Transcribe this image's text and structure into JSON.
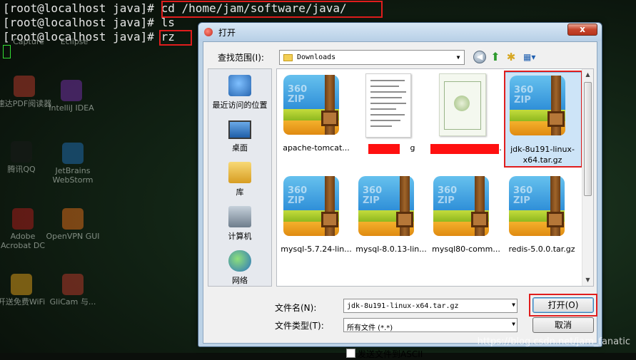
{
  "terminal": {
    "lines": [
      {
        "prompt": "[root@localhost java]# ",
        "cmd": "cd /home/jam/software/java/"
      },
      {
        "prompt": "[root@localhost java]# ",
        "cmd": "ls"
      },
      {
        "prompt": "[root@localhost java]# ",
        "cmd": "rz"
      }
    ]
  },
  "desktop": {
    "icons": [
      "Capture",
      "Eclipse",
      "速达PDF阅读器",
      "IntelliJ IDEA",
      "腾讯QQ",
      "JetBrains WebStorm",
      "Adobe Acrobat DC",
      "OpenVPN GUI",
      "开送免费WiFi",
      "GliCam 与..."
    ]
  },
  "dialog": {
    "title": "打开",
    "close_label": "x",
    "look_in_label": "查找范围(I):",
    "look_in_value": "Downloads",
    "places": [
      "最近访问的位置",
      "桌面",
      "库",
      "计算机",
      "网络"
    ],
    "files": [
      {
        "name": "apache-tomcat...",
        "kind": "archive"
      },
      {
        "name": "g",
        "kind": "doc"
      },
      {
        "name": ".",
        "kind": "cert"
      },
      {
        "name": "jdk-8u191-linux-x64.tar.gz",
        "kind": "archive",
        "selected": true
      },
      {
        "name": "mysql-5.7.24-lin...",
        "kind": "archive"
      },
      {
        "name": "mysql-8.0.13-lin...",
        "kind": "archive"
      },
      {
        "name": "mysql80-comm...",
        "kind": "archive"
      },
      {
        "name": "redis-5.0.0.tar.gz",
        "kind": "archive"
      }
    ],
    "archive_brand_top": "360",
    "archive_brand_bottom": "ZIP",
    "file_name_label": "文件名(N):",
    "file_name_value": "jdk-8u191-linux-x64.tar.gz",
    "file_type_label": "文件类型(T):",
    "file_type_value": "所有文件 (*.*)",
    "open_button": "打开(O)",
    "cancel_button": "取消",
    "ascii_checkbox_label": "发送文件到ASCII"
  },
  "watermark": "https://blog.csdn.net/jam_fanatic",
  "colors": {
    "highlight_box": "#e01d1d",
    "selection": "#cde4f7"
  }
}
